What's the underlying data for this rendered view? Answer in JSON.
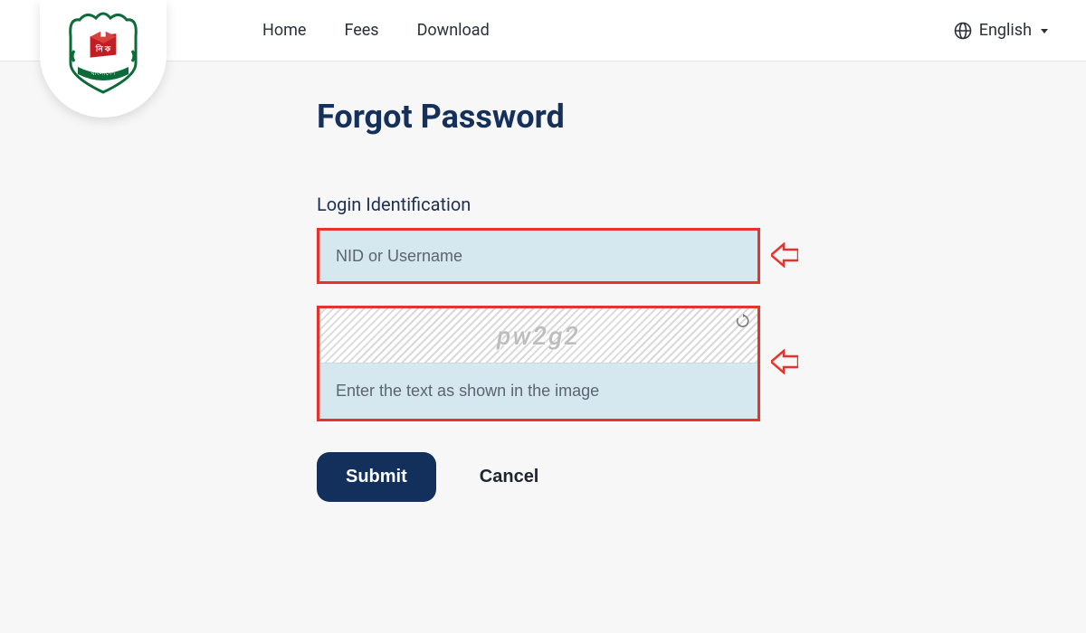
{
  "nav": {
    "home": "Home",
    "fees": "Fees",
    "download": "Download"
  },
  "lang": {
    "label": "English"
  },
  "page": {
    "title": "Forgot Password",
    "login_label": "Login Identification",
    "login_placeholder": "NID or Username",
    "captcha_text": "pw2g2",
    "captcha_placeholder": "Enter the text as shown in the image",
    "submit": "Submit",
    "cancel": "Cancel"
  },
  "colors": {
    "highlight_border": "#e8332d",
    "primary_dark": "#12305b",
    "input_bg": "#d5e7ef"
  }
}
